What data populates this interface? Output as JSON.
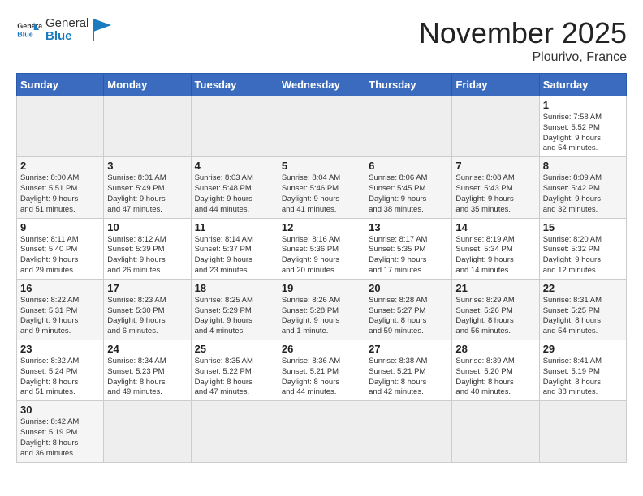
{
  "header": {
    "logo_general": "General",
    "logo_blue": "Blue",
    "month_title": "November 2025",
    "location": "Plourivo, France"
  },
  "days_of_week": [
    "Sunday",
    "Monday",
    "Tuesday",
    "Wednesday",
    "Thursday",
    "Friday",
    "Saturday"
  ],
  "rows": [
    [
      {
        "day": "",
        "info": ""
      },
      {
        "day": "",
        "info": ""
      },
      {
        "day": "",
        "info": ""
      },
      {
        "day": "",
        "info": ""
      },
      {
        "day": "",
        "info": ""
      },
      {
        "day": "",
        "info": ""
      },
      {
        "day": "1",
        "info": "Sunrise: 7:58 AM\nSunset: 5:52 PM\nDaylight: 9 hours\nand 54 minutes."
      }
    ],
    [
      {
        "day": "2",
        "info": "Sunrise: 8:00 AM\nSunset: 5:51 PM\nDaylight: 9 hours\nand 51 minutes."
      },
      {
        "day": "3",
        "info": "Sunrise: 8:01 AM\nSunset: 5:49 PM\nDaylight: 9 hours\nand 47 minutes."
      },
      {
        "day": "4",
        "info": "Sunrise: 8:03 AM\nSunset: 5:48 PM\nDaylight: 9 hours\nand 44 minutes."
      },
      {
        "day": "5",
        "info": "Sunrise: 8:04 AM\nSunset: 5:46 PM\nDaylight: 9 hours\nand 41 minutes."
      },
      {
        "day": "6",
        "info": "Sunrise: 8:06 AM\nSunset: 5:45 PM\nDaylight: 9 hours\nand 38 minutes."
      },
      {
        "day": "7",
        "info": "Sunrise: 8:08 AM\nSunset: 5:43 PM\nDaylight: 9 hours\nand 35 minutes."
      },
      {
        "day": "8",
        "info": "Sunrise: 8:09 AM\nSunset: 5:42 PM\nDaylight: 9 hours\nand 32 minutes."
      }
    ],
    [
      {
        "day": "9",
        "info": "Sunrise: 8:11 AM\nSunset: 5:40 PM\nDaylight: 9 hours\nand 29 minutes."
      },
      {
        "day": "10",
        "info": "Sunrise: 8:12 AM\nSunset: 5:39 PM\nDaylight: 9 hours\nand 26 minutes."
      },
      {
        "day": "11",
        "info": "Sunrise: 8:14 AM\nSunset: 5:37 PM\nDaylight: 9 hours\nand 23 minutes."
      },
      {
        "day": "12",
        "info": "Sunrise: 8:16 AM\nSunset: 5:36 PM\nDaylight: 9 hours\nand 20 minutes."
      },
      {
        "day": "13",
        "info": "Sunrise: 8:17 AM\nSunset: 5:35 PM\nDaylight: 9 hours\nand 17 minutes."
      },
      {
        "day": "14",
        "info": "Sunrise: 8:19 AM\nSunset: 5:34 PM\nDaylight: 9 hours\nand 14 minutes."
      },
      {
        "day": "15",
        "info": "Sunrise: 8:20 AM\nSunset: 5:32 PM\nDaylight: 9 hours\nand 12 minutes."
      }
    ],
    [
      {
        "day": "16",
        "info": "Sunrise: 8:22 AM\nSunset: 5:31 PM\nDaylight: 9 hours\nand 9 minutes."
      },
      {
        "day": "17",
        "info": "Sunrise: 8:23 AM\nSunset: 5:30 PM\nDaylight: 9 hours\nand 6 minutes."
      },
      {
        "day": "18",
        "info": "Sunrise: 8:25 AM\nSunset: 5:29 PM\nDaylight: 9 hours\nand 4 minutes."
      },
      {
        "day": "19",
        "info": "Sunrise: 8:26 AM\nSunset: 5:28 PM\nDaylight: 9 hours\nand 1 minute."
      },
      {
        "day": "20",
        "info": "Sunrise: 8:28 AM\nSunset: 5:27 PM\nDaylight: 8 hours\nand 59 minutes."
      },
      {
        "day": "21",
        "info": "Sunrise: 8:29 AM\nSunset: 5:26 PM\nDaylight: 8 hours\nand 56 minutes."
      },
      {
        "day": "22",
        "info": "Sunrise: 8:31 AM\nSunset: 5:25 PM\nDaylight: 8 hours\nand 54 minutes."
      }
    ],
    [
      {
        "day": "23",
        "info": "Sunrise: 8:32 AM\nSunset: 5:24 PM\nDaylight: 8 hours\nand 51 minutes."
      },
      {
        "day": "24",
        "info": "Sunrise: 8:34 AM\nSunset: 5:23 PM\nDaylight: 8 hours\nand 49 minutes."
      },
      {
        "day": "25",
        "info": "Sunrise: 8:35 AM\nSunset: 5:22 PM\nDaylight: 8 hours\nand 47 minutes."
      },
      {
        "day": "26",
        "info": "Sunrise: 8:36 AM\nSunset: 5:21 PM\nDaylight: 8 hours\nand 44 minutes."
      },
      {
        "day": "27",
        "info": "Sunrise: 8:38 AM\nSunset: 5:21 PM\nDaylight: 8 hours\nand 42 minutes."
      },
      {
        "day": "28",
        "info": "Sunrise: 8:39 AM\nSunset: 5:20 PM\nDaylight: 8 hours\nand 40 minutes."
      },
      {
        "day": "29",
        "info": "Sunrise: 8:41 AM\nSunset: 5:19 PM\nDaylight: 8 hours\nand 38 minutes."
      }
    ],
    [
      {
        "day": "30",
        "info": "Sunrise: 8:42 AM\nSunset: 5:19 PM\nDaylight: 8 hours\nand 36 minutes."
      },
      {
        "day": "",
        "info": ""
      },
      {
        "day": "",
        "info": ""
      },
      {
        "day": "",
        "info": ""
      },
      {
        "day": "",
        "info": ""
      },
      {
        "day": "",
        "info": ""
      },
      {
        "day": "",
        "info": ""
      }
    ]
  ]
}
